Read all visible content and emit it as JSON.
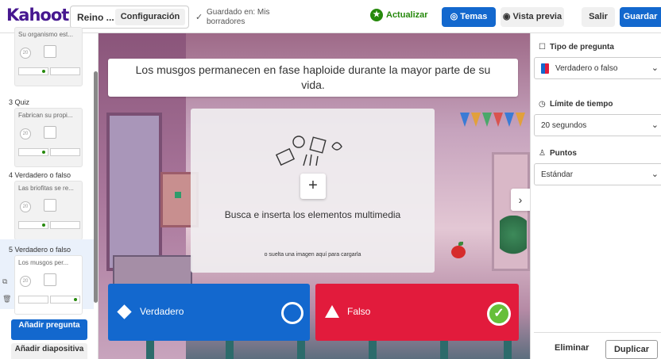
{
  "header": {
    "logo": "Kahoot!",
    "kahoot_title": "Reino ...",
    "settings_label": "Configuración",
    "saved_status": "Guardado en: Mis borradores",
    "update_label": "Actualizar",
    "themes_label": "Temas",
    "preview_label": "Vista previa",
    "exit_label": "Salir",
    "save_label": "Guardar"
  },
  "sidebar": {
    "slides": [
      {
        "label": "",
        "question": "Su organismo est...",
        "timer": "20"
      },
      {
        "label": "3  Quiz",
        "question": "Fabrican su propi...",
        "timer": "20"
      },
      {
        "label": "4  Verdadero o falso",
        "question": "Las briofitas se re...",
        "timer": "20"
      },
      {
        "label": "5  Verdadero o falso",
        "question": "Los musgos per...",
        "timer": "20"
      }
    ],
    "add_question_label": "Añadir pregunta",
    "add_slide_label": "Añadir diapositiva"
  },
  "editor": {
    "question": "Los musgos permanecen en fase haploide durante la mayor parte de su vida.",
    "media_prompt": "Busca e inserta los elementos multimedia",
    "media_drop_hint": "o suelta una imagen aquí para cargarla",
    "answers": [
      {
        "label": "Verdadero",
        "color": "#1368ce",
        "correct": false
      },
      {
        "label": "Falso",
        "color": "#e21b3c",
        "correct": true
      }
    ]
  },
  "settings_panel": {
    "question_type_heading": "Tipo de pregunta",
    "question_type_value": "Verdadero o falso",
    "time_limit_heading": "Límite de tiempo",
    "time_limit_value": "20 segundos",
    "points_heading": "Puntos",
    "points_value": "Estándar",
    "delete_label": "Eliminar",
    "duplicate_label": "Duplicar"
  },
  "colors": {
    "brand": "#46178f",
    "primary": "#1368ce",
    "true_answer": "#1368ce",
    "false_answer": "#e21b3c",
    "correct_check": "#66bf39",
    "update_green": "#26890c"
  }
}
